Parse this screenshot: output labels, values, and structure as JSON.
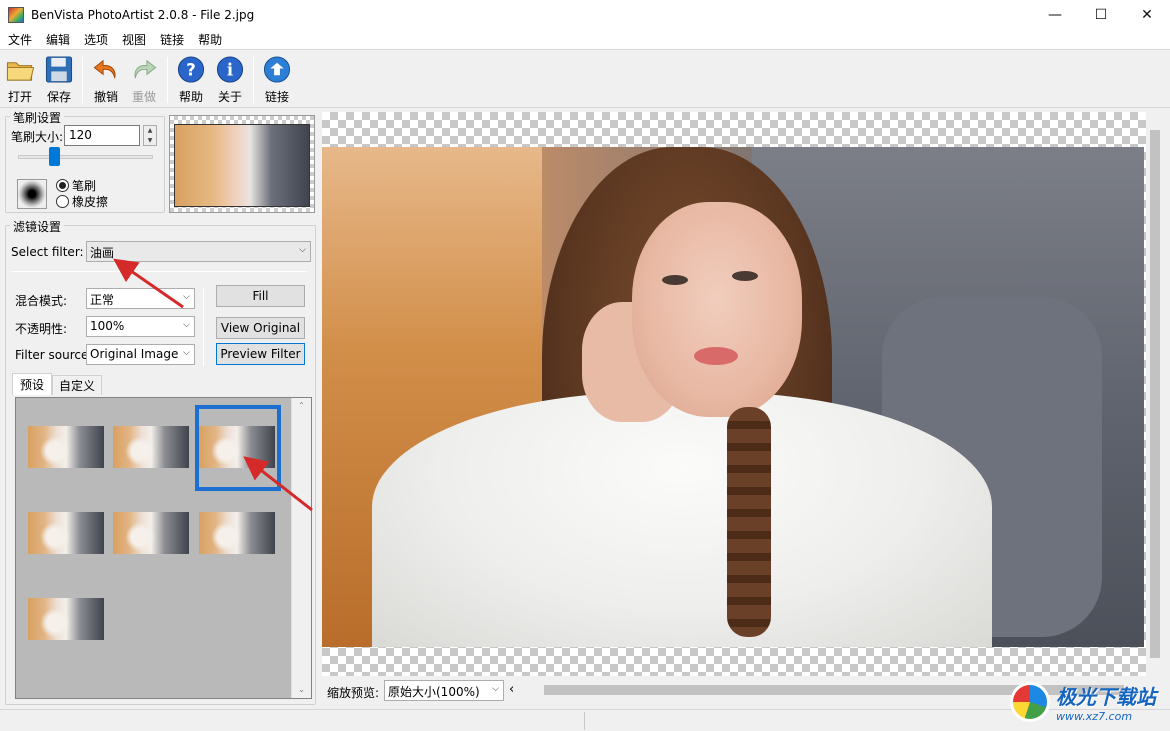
{
  "window": {
    "title": "BenVista PhotoArtist 2.0.8 - File 2.jpg",
    "minimize": "—",
    "maximize": "☐",
    "close": "✕"
  },
  "menu": [
    "文件",
    "编辑",
    "选项",
    "视图",
    "链接",
    "帮助"
  ],
  "toolbar": {
    "open": "打开",
    "save": "保存",
    "undo": "撤销",
    "redo": "重做",
    "help": "帮助",
    "about": "关于",
    "link": "链接"
  },
  "brush": {
    "group_title": "笔刷设置",
    "size_label": "笔刷大小:",
    "size_value": "120",
    "size_fraction": 0.27,
    "mode_brush": "笔刷",
    "mode_eraser": "橡皮擦",
    "selected_mode": "brush"
  },
  "filter": {
    "group_title": "滤镜设置",
    "select_label": "Select filter:",
    "selected_filter": "油画",
    "blend_label": "混合模式:",
    "blend_value": "正常",
    "opacity_label": "不透明性:",
    "opacity_value": "100%",
    "source_label": "Filter source:",
    "source_value": "Original Image",
    "fill_button": "Fill",
    "view_original_button": "View Original",
    "preview_filter_button": "Preview Filter"
  },
  "tabs": {
    "presets": "预设",
    "custom": "自定义"
  },
  "presets": {
    "count": 7,
    "selected_index": 2
  },
  "zoom": {
    "label": "缩放预览:",
    "value": "原始大小(100%)"
  },
  "watermark": {
    "brand": "极光下载站",
    "url": "www.xz7.com"
  },
  "colors": {
    "accent": "#0078d7",
    "selection": "#1a6fd1",
    "annotation_arrow": "#d42a2a"
  }
}
